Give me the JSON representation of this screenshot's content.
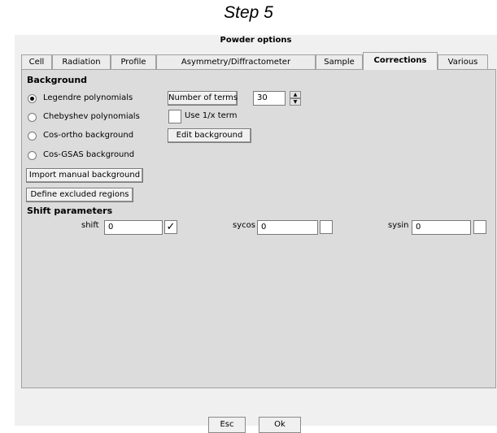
{
  "step_title": "Step 5",
  "window": {
    "title": "Powder options"
  },
  "tabs": [
    {
      "label": "Cell"
    },
    {
      "label": "Radiation"
    },
    {
      "label": "Profile"
    },
    {
      "label": "Asymmetry/Diffractometer"
    },
    {
      "label": "Sample"
    },
    {
      "label": "Corrections",
      "active": true
    },
    {
      "label": "Various"
    }
  ],
  "background": {
    "heading": "Background",
    "options": [
      {
        "label": "Legendre polynomials",
        "selected": true
      },
      {
        "label": "Chebyshev polynomials",
        "selected": false
      },
      {
        "label": "Cos-ortho background",
        "selected": false
      },
      {
        "label": "Cos-GSAS background",
        "selected": false
      }
    ],
    "number_of_terms_label": "Number of terms",
    "number_of_terms_value": "30",
    "use_1x_label": "Use 1/x term",
    "use_1x_checked": false,
    "edit_background_label": "Edit background",
    "import_manual_label": "Import manual background",
    "define_excluded_label": "Define excluded regions"
  },
  "shift": {
    "heading": "Shift parameters",
    "params": [
      {
        "name": "shift",
        "value": "0",
        "refine": true
      },
      {
        "name": "sycos",
        "value": "0",
        "refine": false
      },
      {
        "name": "sysin",
        "value": "0",
        "refine": false
      }
    ]
  },
  "buttons": {
    "esc": "Esc",
    "ok": "Ok"
  }
}
